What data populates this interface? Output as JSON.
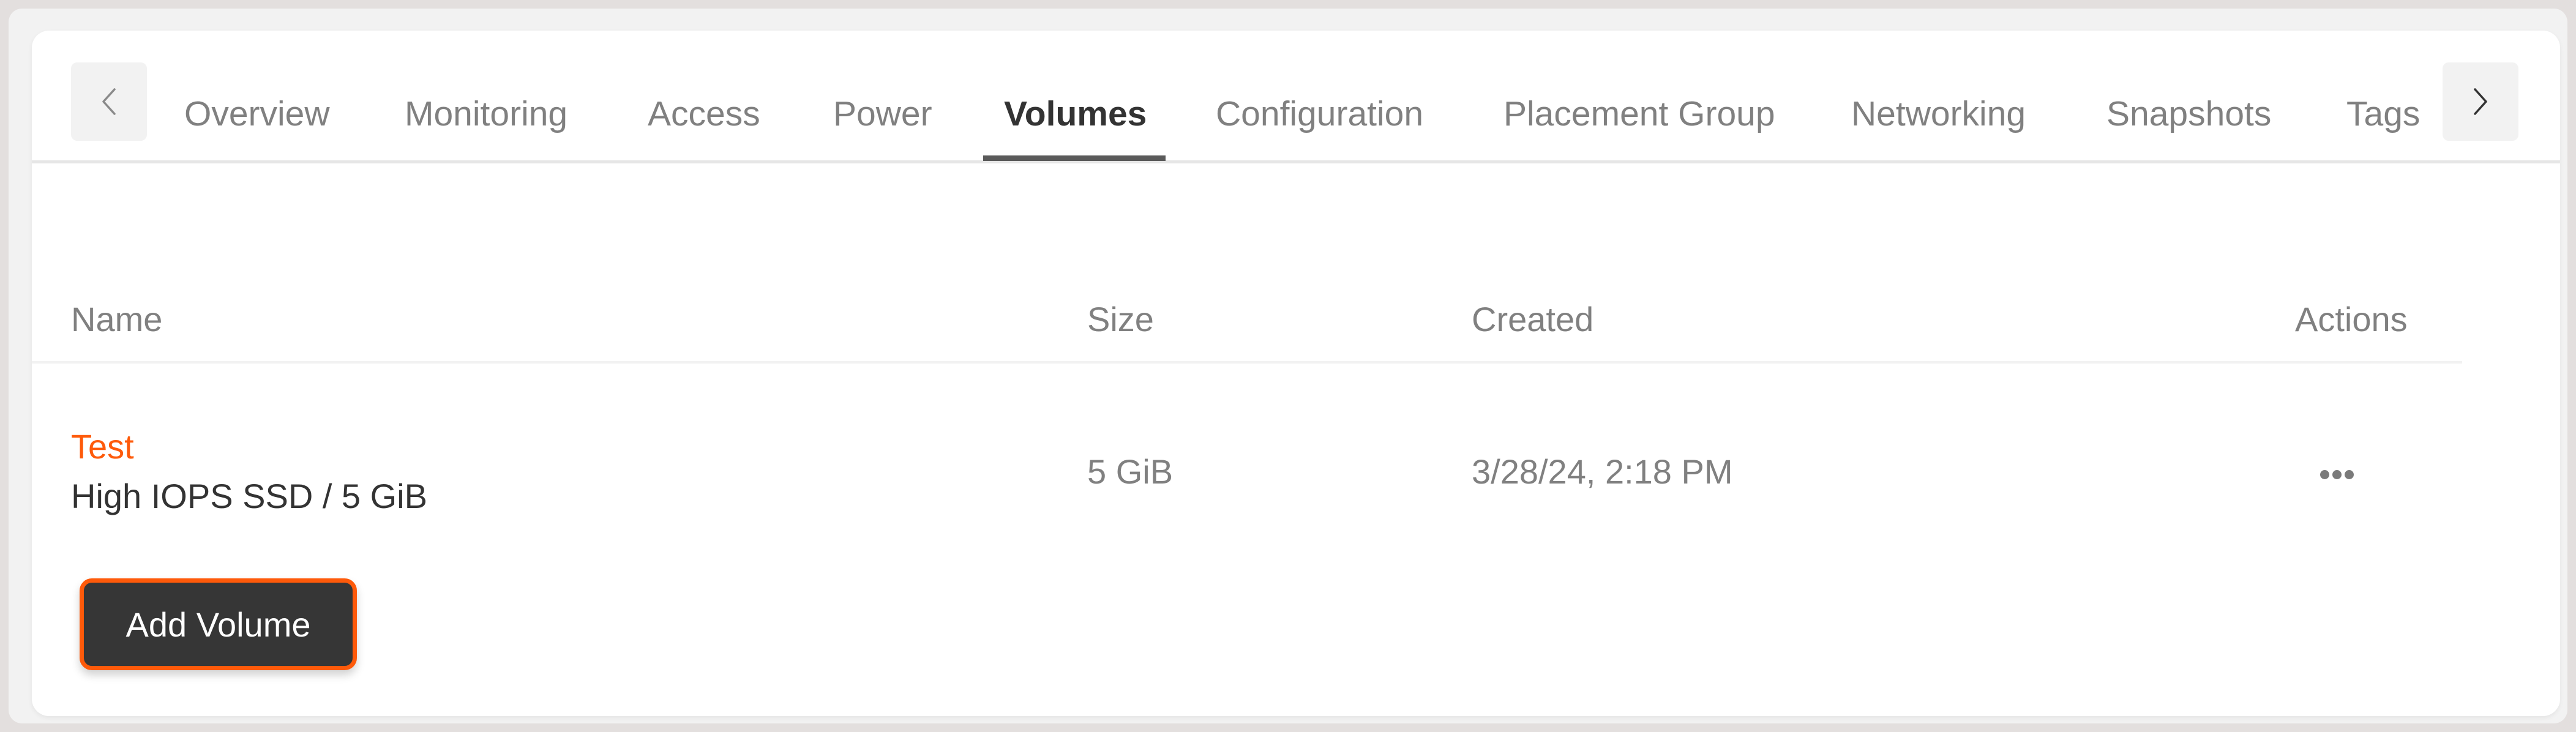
{
  "tabs": {
    "prev_icon": "chevron-left-icon",
    "next_icon": "chevron-right-icon",
    "items": [
      {
        "label": "Overview",
        "active": false
      },
      {
        "label": "Monitoring",
        "active": false
      },
      {
        "label": "Access",
        "active": false
      },
      {
        "label": "Power",
        "active": false
      },
      {
        "label": "Volumes",
        "active": true
      },
      {
        "label": "Configuration",
        "active": false
      },
      {
        "label": "Placement Group",
        "active": false
      },
      {
        "label": "Networking",
        "active": false
      },
      {
        "label": "Snapshots",
        "active": false
      },
      {
        "label": "Tags",
        "active": false
      }
    ]
  },
  "table": {
    "columns": [
      "Name",
      "Size",
      "Created",
      "Actions"
    ],
    "rows": [
      {
        "name": "Test",
        "description": "High IOPS SSD / 5 GiB",
        "size": "5 GiB",
        "created": "3/28/24, 2:18 PM",
        "actions_icon": "more-horizontal-icon"
      }
    ]
  },
  "add_button_label": "Add Volume",
  "colors": {
    "accent": "#fe5a0a",
    "button_bg": "#363636",
    "active_tab": "#333333",
    "muted_text": "#808080"
  }
}
